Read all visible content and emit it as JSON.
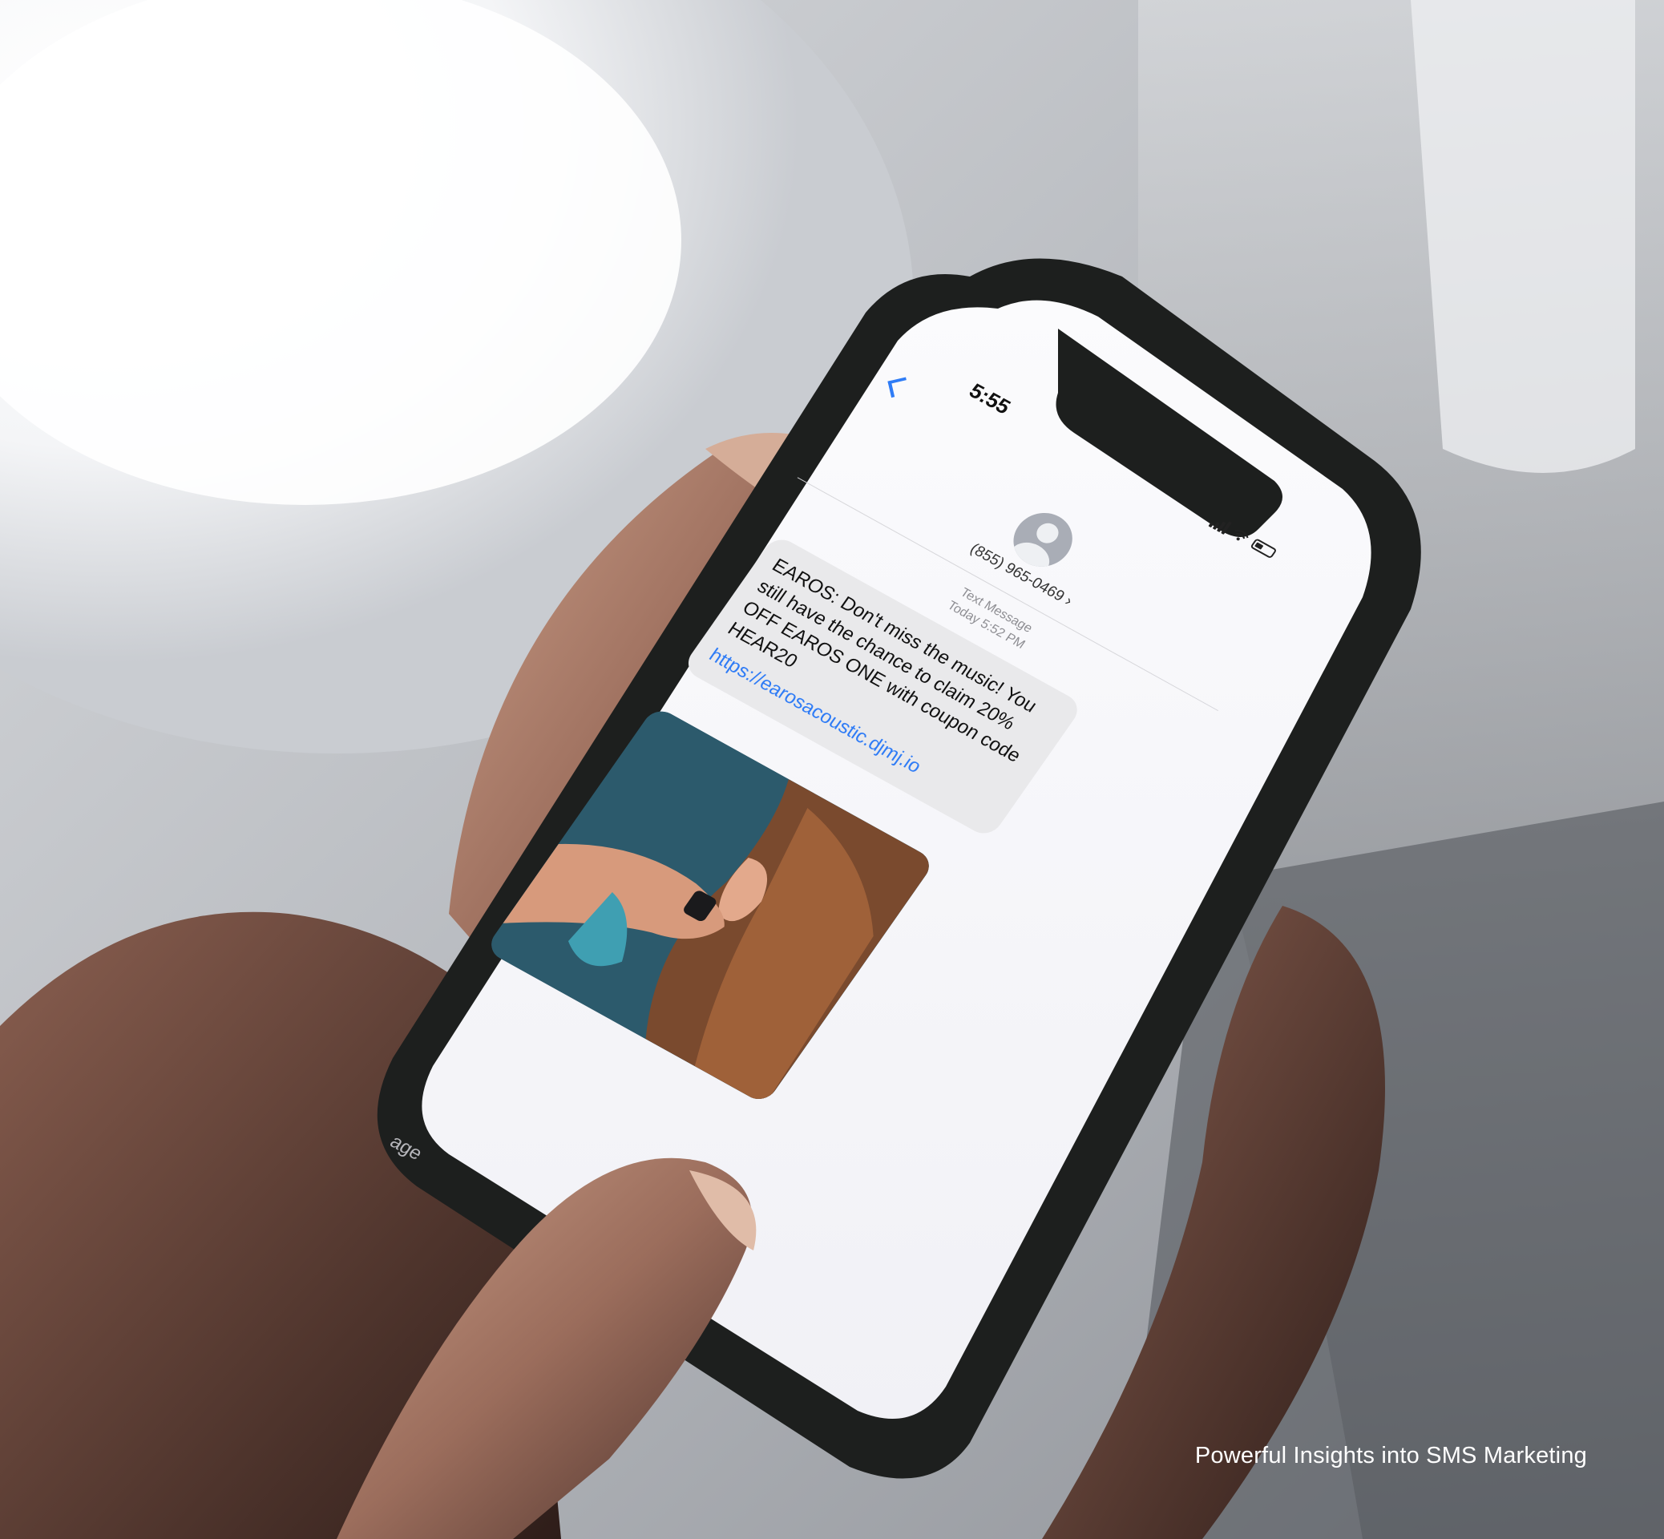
{
  "phone": {
    "status_time": "5:55",
    "contact_number": "(855) 965-0469 ›",
    "message_type": "Text Message",
    "message_time": "Today 5:52 PM",
    "message_text": "EAROS: Don't miss the music! You still have the chance to claim 20% OFF EAROS ONE with coupon code HEAR20",
    "message_link": "https://earosacoustic.djmj.io",
    "input_placeholder_fragment": "age"
  },
  "caption": "Powerful Insights into SMS Marketing",
  "colors": {
    "ios_blue": "#2f7cf6",
    "bubble_gray": "#e9e9eb",
    "phone_case": "#1d1f1e",
    "caption_text": "#ffffff"
  }
}
